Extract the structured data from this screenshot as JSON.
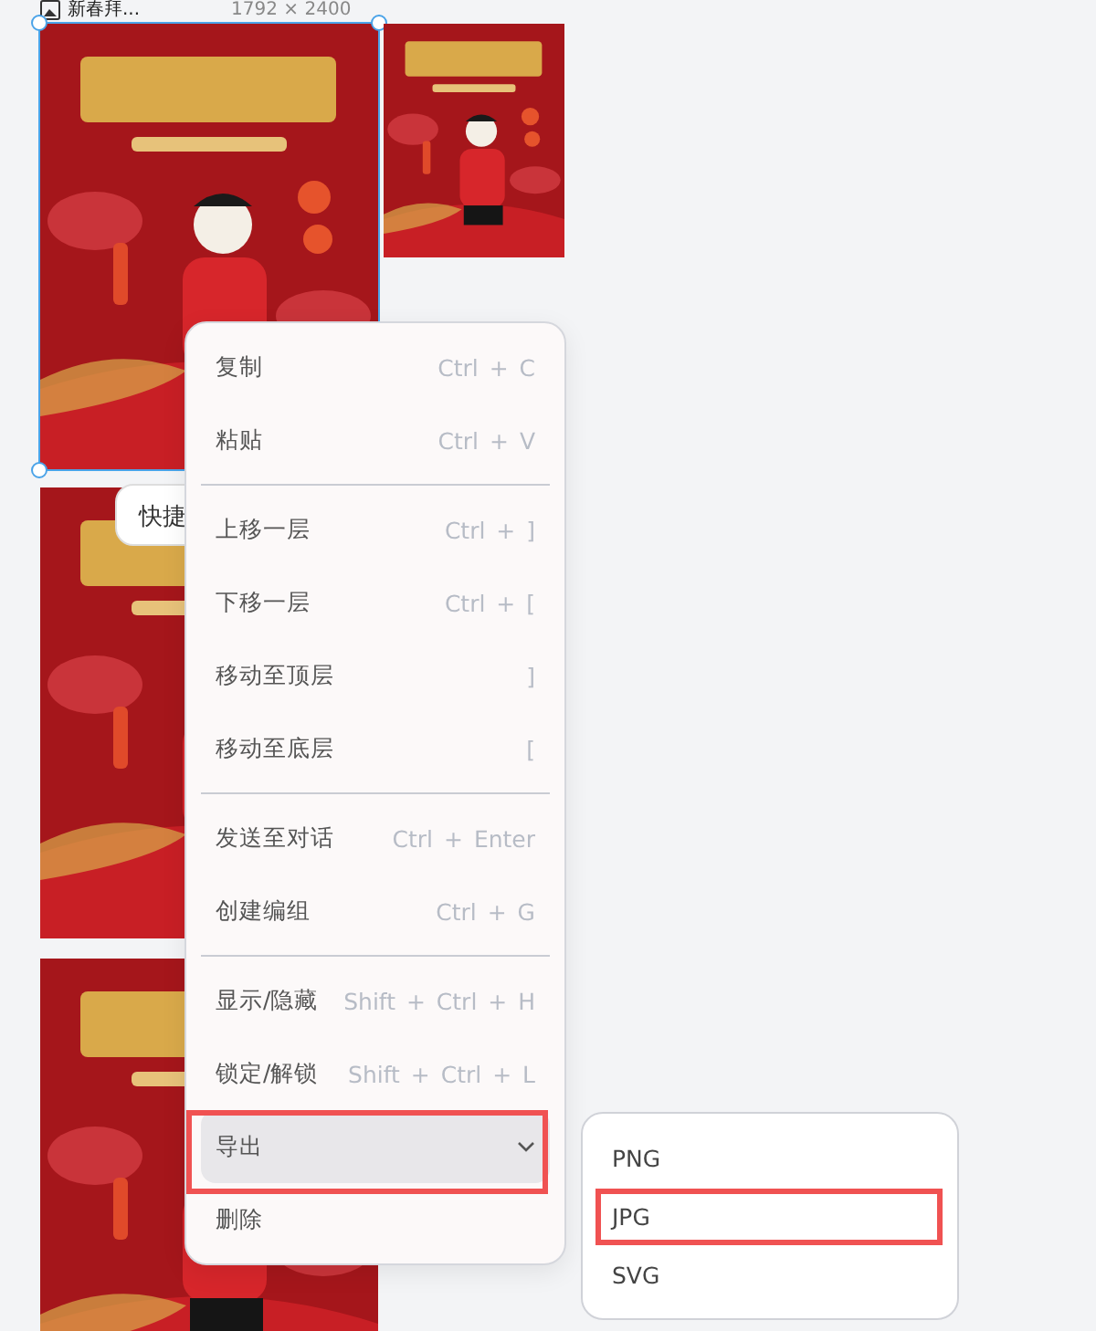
{
  "canvas": {
    "file_label": {
      "name": "新春拜...",
      "size": "1792 × 2400"
    },
    "images": [
      {
        "kind": "picture",
        "selected": true
      },
      {
        "kind": "picture",
        "selected": false
      },
      {
        "kind": "picture",
        "selected": false
      },
      {
        "kind": "picture",
        "selected": false
      }
    ]
  },
  "tooltip": "快捷",
  "context_menu": {
    "groups": [
      [
        {
          "label": "复制",
          "shortcut": "Ctrl + C",
          "kind": "item",
          "hovered": false,
          "annotated": false
        },
        {
          "label": "粘贴",
          "shortcut": "Ctrl + V",
          "kind": "item",
          "hovered": false,
          "annotated": false
        }
      ],
      [
        {
          "label": "上移一层",
          "shortcut": "Ctrl + ]",
          "kind": "item",
          "hovered": false,
          "annotated": false
        },
        {
          "label": "下移一层",
          "shortcut": "Ctrl + [",
          "kind": "item",
          "hovered": false,
          "annotated": false
        },
        {
          "label": "移动至顶层",
          "shortcut": "]",
          "kind": "item",
          "hovered": false,
          "annotated": false
        },
        {
          "label": "移动至底层",
          "shortcut": "[",
          "kind": "item",
          "hovered": false,
          "annotated": false
        }
      ],
      [
        {
          "label": "发送至对话",
          "shortcut": "Ctrl + Enter",
          "kind": "item",
          "hovered": false,
          "annotated": false
        },
        {
          "label": "创建编组",
          "shortcut": "Ctrl + G",
          "kind": "item",
          "hovered": false,
          "annotated": false
        }
      ],
      [
        {
          "label": "显示/隐藏",
          "shortcut": "Shift + Ctrl + H",
          "kind": "item",
          "hovered": false,
          "annotated": false
        },
        {
          "label": "锁定/解锁",
          "shortcut": "Shift + Ctrl + L",
          "kind": "item",
          "hovered": false,
          "annotated": false
        },
        {
          "label": "导出",
          "kind": "submenu",
          "hovered": true,
          "annotated": true
        },
        {
          "label": "删除",
          "kind": "item",
          "hovered": false,
          "annotated": false
        }
      ]
    ]
  },
  "submenu": {
    "items": [
      {
        "label": "PNG",
        "annotated": false
      },
      {
        "label": "JPG",
        "annotated": true
      },
      {
        "label": "SVG",
        "annotated": false
      }
    ]
  }
}
